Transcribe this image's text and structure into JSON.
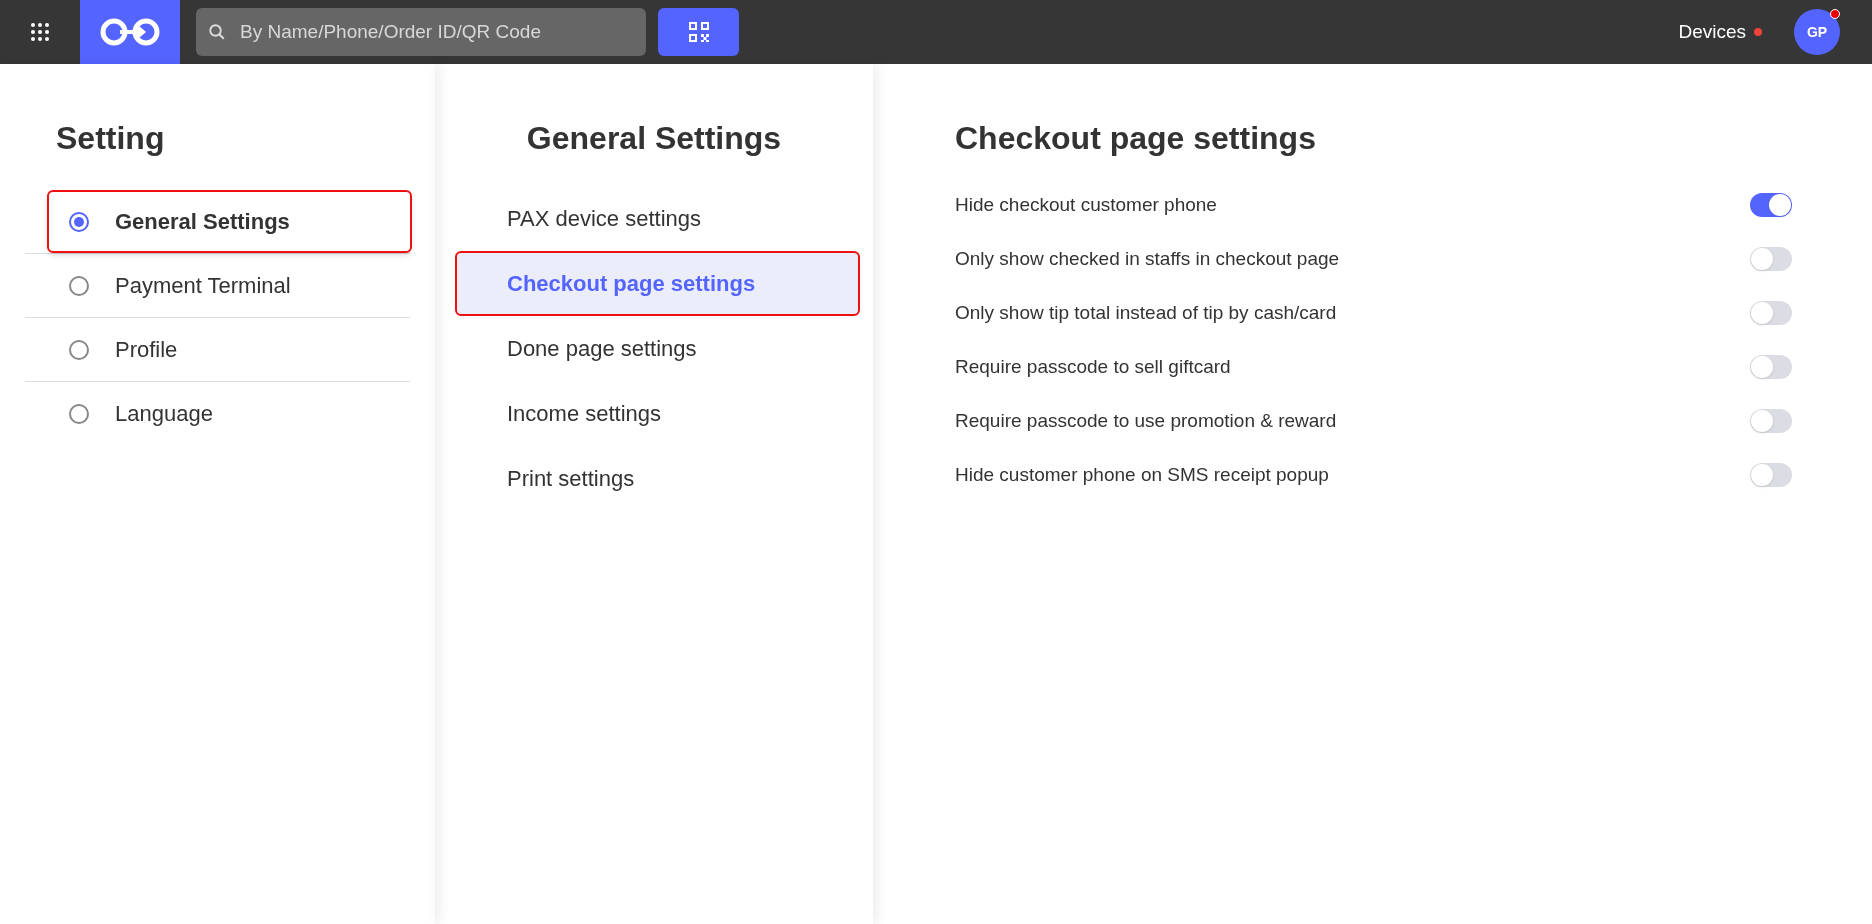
{
  "top_bar": {
    "search": {
      "placeholder": "By Name/Phone/Order ID/QR Code"
    },
    "devices": {
      "label": "Devices",
      "alert": true
    },
    "avatar": {
      "initials": "GP",
      "alert": true
    }
  },
  "setting_menu": {
    "title": "Setting",
    "items": [
      {
        "label": "General Settings",
        "selected": true,
        "highlighted": true
      },
      {
        "label": "Payment Terminal",
        "selected": false,
        "highlighted": false
      },
      {
        "label": "Profile",
        "selected": false,
        "highlighted": false
      },
      {
        "label": "Language",
        "selected": false,
        "highlighted": false
      }
    ]
  },
  "general_settings": {
    "title": "General Settings",
    "items": [
      {
        "label": "PAX device settings",
        "selected": false,
        "highlighted": false
      },
      {
        "label": "Checkout page settings",
        "selected": true,
        "highlighted": true
      },
      {
        "label": "Done page settings",
        "selected": false,
        "highlighted": false
      },
      {
        "label": "Income settings",
        "selected": false,
        "highlighted": false
      },
      {
        "label": "Print settings",
        "selected": false,
        "highlighted": false
      }
    ]
  },
  "checkout_settings": {
    "title": "Checkout page settings",
    "options": [
      {
        "label": "Hide checkout customer phone",
        "on": true
      },
      {
        "label": "Only show checked in staffs in checkout page",
        "on": false
      },
      {
        "label": "Only show tip total instead of tip by cash/card",
        "on": false
      },
      {
        "label": "Require passcode to sell giftcard",
        "on": false
      },
      {
        "label": "Require passcode to use promotion & reward",
        "on": false
      },
      {
        "label": "Hide customer phone on SMS receipt popup",
        "on": false
      }
    ]
  }
}
